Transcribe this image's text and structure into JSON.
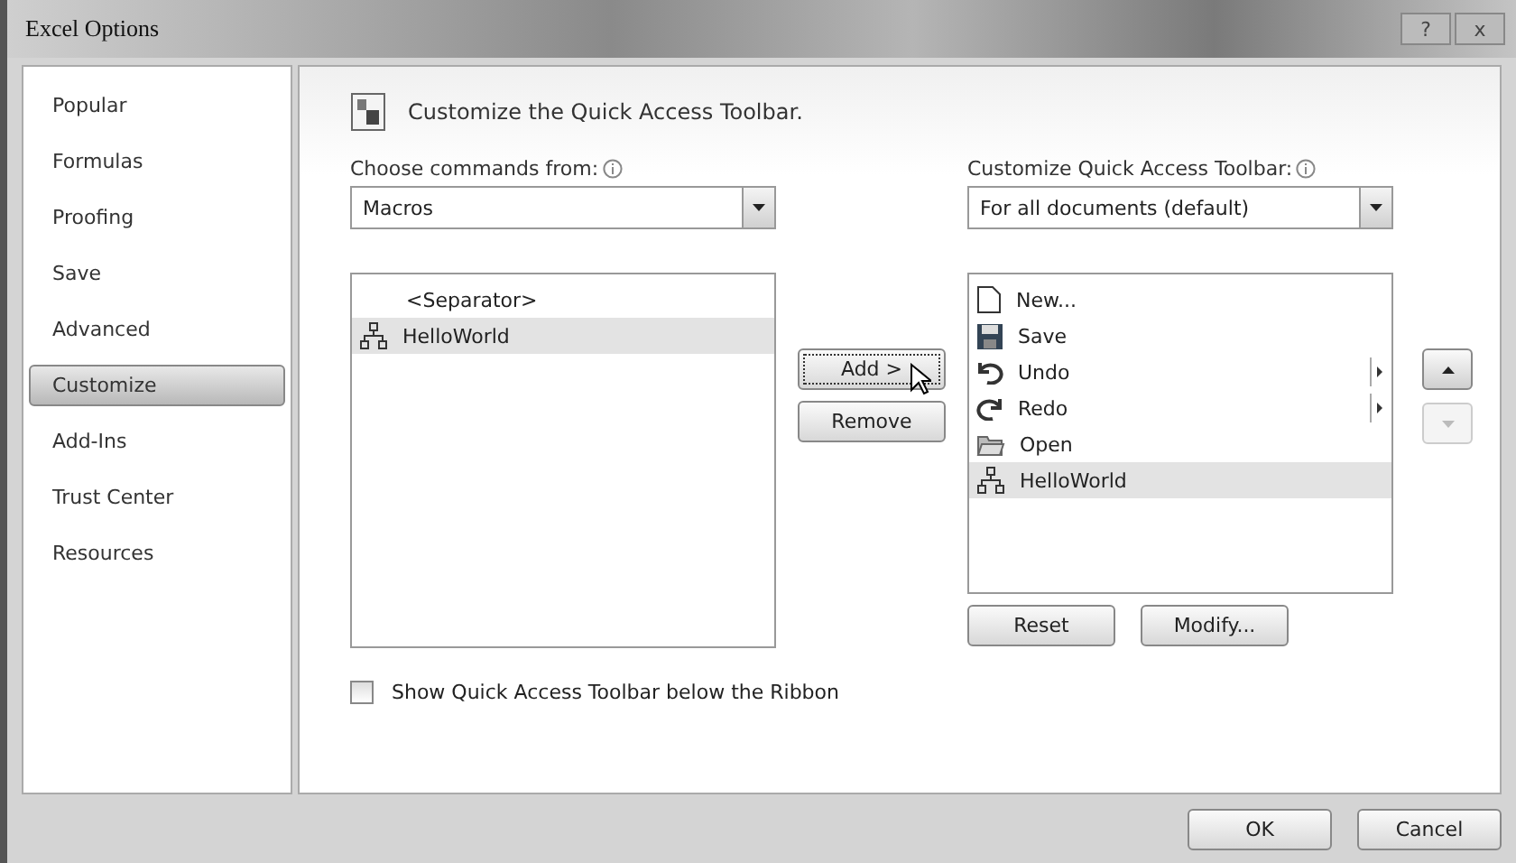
{
  "window": {
    "title": "Excel Options",
    "buttons": [
      "?",
      "x"
    ]
  },
  "sidebar": {
    "items": [
      {
        "label": "Popular",
        "selected": false
      },
      {
        "label": "Formulas",
        "selected": false
      },
      {
        "label": "Proofing",
        "selected": false
      },
      {
        "label": "Save",
        "selected": false
      },
      {
        "label": "Advanced",
        "selected": false
      },
      {
        "label": "Customize",
        "selected": true
      },
      {
        "label": "Add-Ins",
        "selected": false
      },
      {
        "label": "Trust Center",
        "selected": false
      },
      {
        "label": "Resources",
        "selected": false
      }
    ]
  },
  "heading": "Customize the Quick Access Toolbar.",
  "left": {
    "label": "Choose commands from:",
    "dropdown": "Macros",
    "items": [
      {
        "label": "<Separator>",
        "kind": "separator",
        "selected": false
      },
      {
        "label": "HelloWorld",
        "kind": "macro",
        "selected": true
      }
    ]
  },
  "middle": {
    "buttons": [
      {
        "label": "Add >",
        "focused": true
      },
      {
        "label": "Remove",
        "focused": false
      }
    ]
  },
  "right": {
    "label": "Customize Quick Access Toolbar:",
    "dropdown": "For all documents (default)",
    "items": [
      {
        "label": "New...",
        "kind": "new",
        "submenu": false,
        "selected": false
      },
      {
        "label": "Save",
        "kind": "save",
        "submenu": false,
        "selected": false
      },
      {
        "label": "Undo",
        "kind": "undo",
        "submenu": true,
        "selected": false
      },
      {
        "label": "Redo",
        "kind": "redo",
        "submenu": true,
        "selected": false
      },
      {
        "label": "Open",
        "kind": "open",
        "submenu": false,
        "selected": false
      },
      {
        "label": "HelloWorld",
        "kind": "macro",
        "submenu": false,
        "selected": true
      }
    ],
    "buttons": [
      "Reset",
      "Modify..."
    ],
    "move_up_disabled": false,
    "move_down_disabled": true
  },
  "checkbox": {
    "label": "Show Quick Access Toolbar below the Ribbon",
    "checked": false
  },
  "footer": {
    "buttons": [
      "OK",
      "Cancel"
    ]
  }
}
